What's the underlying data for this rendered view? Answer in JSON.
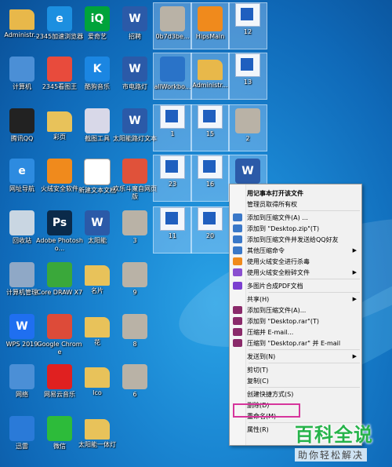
{
  "desktop": {
    "icons": [
      {
        "label": "Administr...",
        "icon": "folder-user-icon",
        "color": "#e8b84a",
        "text": ""
      },
      {
        "label": "2345加速浏览器",
        "icon": "browser-icon",
        "color": "#1c8fe0",
        "text": "e"
      },
      {
        "label": "爱奇艺",
        "icon": "iqiyi-icon",
        "color": "#00a33b",
        "text": "iQ"
      },
      {
        "label": "招聘",
        "icon": "word-doc-icon",
        "color": "#2b5aa8",
        "text": "W"
      },
      {
        "label": "0b7d3be...",
        "icon": "image-thumb-icon",
        "color": "#b9b2a6",
        "text": ""
      },
      {
        "label": "HipsMain",
        "icon": "fire-shield-icon",
        "color": "#f08a1c",
        "text": ""
      },
      {
        "label": "12",
        "icon": "doc-thumb-icon",
        "color": "#f2f6fb",
        "text": ""
      },
      {
        "label": "计算机",
        "icon": "computer-icon",
        "color": "#4b8fd6",
        "text": ""
      },
      {
        "label": "2345看图王",
        "icon": "photo-viewer-icon",
        "color": "#e84b3c",
        "text": ""
      },
      {
        "label": "酷狗音乐",
        "icon": "kugou-icon",
        "color": "#1b86e2",
        "text": "K"
      },
      {
        "label": "市电路灯",
        "icon": "word-doc-icon",
        "color": "#2b5aa8",
        "text": "W"
      },
      {
        "label": "allWorkbo...",
        "icon": "app-icon",
        "color": "#2a73c8",
        "text": ""
      },
      {
        "label": "Administr...",
        "icon": "folder-user-icon",
        "color": "#e8b84a",
        "text": ""
      },
      {
        "label": "13",
        "icon": "doc-thumb-icon",
        "color": "#f2f6fb",
        "text": ""
      },
      {
        "label": "腾讯QQ",
        "icon": "qq-icon",
        "color": "#222222",
        "text": ""
      },
      {
        "label": "彩页",
        "icon": "folder-icon",
        "color": "#e8c25a",
        "text": ""
      },
      {
        "label": "截图工具",
        "icon": "snipping-tool-icon",
        "color": "#d8d8e8",
        "text": ""
      },
      {
        "label": "太阳能路灯文本",
        "icon": "word-doc-icon",
        "color": "#2b5aa8",
        "text": "W"
      },
      {
        "label": "1",
        "icon": "doc-thumb-icon",
        "color": "#f2f6fb",
        "text": ""
      },
      {
        "label": "15",
        "icon": "doc-thumb-icon",
        "color": "#f2f6fb",
        "text": ""
      },
      {
        "label": "2",
        "icon": "image-thumb-icon",
        "color": "#b9b2a6",
        "text": ""
      },
      {
        "label": "网址导航",
        "icon": "ie-icon",
        "color": "#2d8be0",
        "text": "e"
      },
      {
        "label": "火绒安全软件",
        "icon": "huorong-icon",
        "color": "#f08a1c",
        "text": ""
      },
      {
        "label": "新建文本文档",
        "icon": "text-doc-icon",
        "color": "#ffffff",
        "text": ""
      },
      {
        "label": "欢乐斗魔自网页版",
        "icon": "game-icon",
        "color": "#e0523a",
        "text": ""
      },
      {
        "label": "23",
        "icon": "doc-thumb-icon",
        "color": "#f2f6fb",
        "text": ""
      },
      {
        "label": "16",
        "icon": "doc-thumb-icon",
        "color": "#f2f6fb",
        "text": ""
      },
      {
        "label": "",
        "icon": "word-doc-icon",
        "color": "#2b5aa8",
        "text": "W"
      },
      {
        "label": "回收站",
        "icon": "recycle-bin-icon",
        "color": "#c9d6e2",
        "text": ""
      },
      {
        "label": "Adobe Photosho...",
        "icon": "photoshop-icon",
        "color": "#0a2a4a",
        "text": "Ps"
      },
      {
        "label": "太阳能",
        "icon": "word-doc-icon",
        "color": "#2b5aa8",
        "text": "W"
      },
      {
        "label": "3",
        "icon": "image-thumb-icon",
        "color": "#b9b2a6",
        "text": ""
      },
      {
        "label": "11",
        "icon": "doc-thumb-icon",
        "color": "#f2f6fb",
        "text": ""
      },
      {
        "label": "20",
        "icon": "doc-thumb-icon",
        "color": "#f2f6fb",
        "text": ""
      },
      {
        "label": "计算机管理",
        "icon": "computer-management-icon",
        "color": "#8fa8c6",
        "text": ""
      },
      {
        "label": "Core DRAW X7",
        "icon": "coreldraw-icon",
        "color": "#3aa83a",
        "text": ""
      },
      {
        "label": "名片",
        "icon": "folder-icon",
        "color": "#e8c25a",
        "text": ""
      },
      {
        "label": "9",
        "icon": "image-thumb-icon",
        "color": "#b9b2a6",
        "text": ""
      },
      {
        "label": "WPS 2019",
        "icon": "wps-icon",
        "color": "#1f6ff0",
        "text": "W"
      },
      {
        "label": "Google Chrome",
        "icon": "chrome-icon",
        "color": "#dd4b39",
        "text": ""
      },
      {
        "label": "花",
        "icon": "folder-icon",
        "color": "#e8c25a",
        "text": ""
      },
      {
        "label": "8",
        "icon": "image-thumb-icon",
        "color": "#b9b2a6",
        "text": ""
      },
      {
        "label": "网络",
        "icon": "network-icon",
        "color": "#4b8fd6",
        "text": ""
      },
      {
        "label": "网易云音乐",
        "icon": "netease-music-icon",
        "color": "#e02020",
        "text": ""
      },
      {
        "label": "Ico",
        "icon": "folder-icon",
        "color": "#e8c25a",
        "text": ""
      },
      {
        "label": "6",
        "icon": "image-thumb-icon",
        "color": "#b9b2a6",
        "text": ""
      },
      {
        "label": "迅雷",
        "icon": "thunder-icon",
        "color": "#2a7ad8",
        "text": ""
      },
      {
        "label": "微信",
        "icon": "wechat-icon",
        "color": "#2dbb3a",
        "text": ""
      },
      {
        "label": "太阳能一体灯",
        "icon": "folder-icon",
        "color": "#e8c25a",
        "text": ""
      }
    ]
  },
  "context_menu": {
    "items": [
      {
        "label": "用记事本打开该文件",
        "icon": "",
        "bold": true,
        "arrow": false
      },
      {
        "label": "管理员取得所有权",
        "icon": "",
        "bold": false,
        "arrow": false
      },
      {
        "sep": true
      },
      {
        "label": "添加到压缩文件(A) ...",
        "icon": "archive-icon",
        "bold": false,
        "arrow": false
      },
      {
        "label": "添加到 \"Desktop.zip\"(T)",
        "icon": "archive-icon",
        "bold": false,
        "arrow": false
      },
      {
        "label": "添加到压缩文件并发送给QQ好友",
        "icon": "archive-icon",
        "bold": false,
        "arrow": false
      },
      {
        "label": "其他压缩命令",
        "icon": "archive-icon",
        "bold": false,
        "arrow": true
      },
      {
        "label": "使用火绒安全进行杀毒",
        "icon": "huorong-icon",
        "bold": false,
        "arrow": false
      },
      {
        "label": "使用火绒安全粉碎文件",
        "icon": "shred-icon",
        "bold": false,
        "arrow": true
      },
      {
        "sep": true
      },
      {
        "label": "多图片合成PDF文档",
        "icon": "pdf-icon",
        "bold": false,
        "arrow": false
      },
      {
        "sep": true
      },
      {
        "label": "共享(H)",
        "icon": "",
        "bold": false,
        "arrow": true
      },
      {
        "label": "添加到压缩文件(A)...",
        "icon": "rar-icon",
        "bold": false,
        "arrow": false
      },
      {
        "label": "添加到 \"Desktop.rar\"(T)",
        "icon": "rar-icon",
        "bold": false,
        "arrow": false
      },
      {
        "label": "压缩并 E-mail...",
        "icon": "rar-icon",
        "bold": false,
        "arrow": false
      },
      {
        "label": "压缩到 \"Desktop.rar\" 并 E-mail",
        "icon": "rar-icon",
        "bold": false,
        "arrow": false
      },
      {
        "sep": true
      },
      {
        "label": "发送到(N)",
        "icon": "",
        "bold": false,
        "arrow": true
      },
      {
        "sep": true
      },
      {
        "label": "剪切(T)",
        "icon": "",
        "bold": false,
        "arrow": false
      },
      {
        "label": "复制(C)",
        "icon": "",
        "bold": false,
        "arrow": false
      },
      {
        "sep": true
      },
      {
        "label": "创建快捷方式(S)",
        "icon": "",
        "bold": false,
        "arrow": false
      },
      {
        "label": "删除(D)",
        "icon": "",
        "bold": false,
        "arrow": false
      },
      {
        "label": "重命名(M)",
        "icon": "",
        "bold": false,
        "arrow": false
      },
      {
        "sep": true
      },
      {
        "label": "属性(R)",
        "icon": "",
        "bold": false,
        "arrow": false
      }
    ]
  },
  "watermark": {
    "title": "百科全说",
    "subtitle": "助你轻松解决"
  },
  "colors": {
    "menu_icon_archive": "#3a78c8",
    "menu_icon_huorong": "#f08a1c",
    "menu_icon_shred": "#8a4fd0",
    "menu_icon_pdf": "#7b3fd0",
    "menu_icon_rar": "#8a2a6a",
    "highlight": "#d6359c"
  }
}
